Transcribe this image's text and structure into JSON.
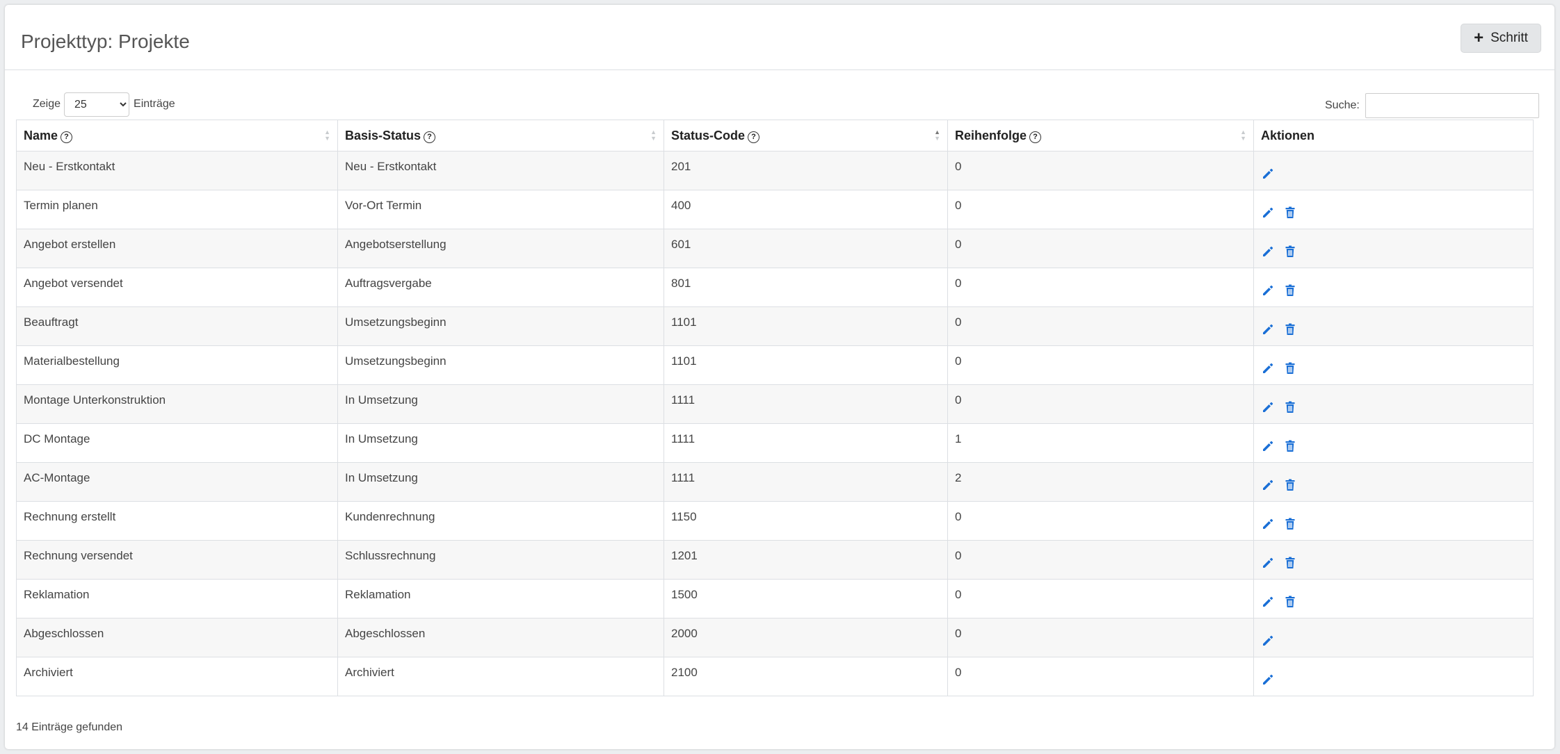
{
  "header": {
    "title": "Projekttyp: Projekte",
    "add_button_label": "Schritt"
  },
  "length": {
    "prefix": "Zeige",
    "value": "25",
    "suffix": "Einträge"
  },
  "search": {
    "label": "Suche:",
    "value": ""
  },
  "columns": [
    "Name",
    "Basis-Status",
    "Status-Code",
    "Reihenfolge",
    "Aktionen"
  ],
  "rows": [
    {
      "name": "Neu - Erstkontakt",
      "basis": "Neu - Erstkontakt",
      "code": "201",
      "order": "0",
      "deletable": false
    },
    {
      "name": "Termin planen",
      "basis": "Vor-Ort Termin",
      "code": "400",
      "order": "0",
      "deletable": true
    },
    {
      "name": "Angebot erstellen",
      "basis": "Angebotserstellung",
      "code": "601",
      "order": "0",
      "deletable": true
    },
    {
      "name": "Angebot versendet",
      "basis": "Auftragsvergabe",
      "code": "801",
      "order": "0",
      "deletable": true
    },
    {
      "name": "Beauftragt",
      "basis": "Umsetzungsbeginn",
      "code": "1101",
      "order": "0",
      "deletable": true
    },
    {
      "name": "Materialbestellung",
      "basis": "Umsetzungsbeginn",
      "code": "1101",
      "order": "0",
      "deletable": true
    },
    {
      "name": "Montage Unterkonstruktion",
      "basis": "In Umsetzung",
      "code": "1111",
      "order": "0",
      "deletable": true
    },
    {
      "name": "DC Montage",
      "basis": "In Umsetzung",
      "code": "1111",
      "order": "1",
      "deletable": true
    },
    {
      "name": "AC-Montage",
      "basis": "In Umsetzung",
      "code": "1111",
      "order": "2",
      "deletable": true
    },
    {
      "name": "Rechnung erstellt",
      "basis": "Kundenrechnung",
      "code": "1150",
      "order": "0",
      "deletable": true
    },
    {
      "name": "Rechnung versendet",
      "basis": "Schlussrechnung",
      "code": "1201",
      "order": "0",
      "deletable": true
    },
    {
      "name": "Reklamation",
      "basis": "Reklamation",
      "code": "1500",
      "order": "0",
      "deletable": true
    },
    {
      "name": "Abgeschlossen",
      "basis": "Abgeschlossen",
      "code": "2000",
      "order": "0",
      "deletable": false
    },
    {
      "name": "Archiviert",
      "basis": "Archiviert",
      "code": "2100",
      "order": "0",
      "deletable": false
    }
  ],
  "footer": {
    "info": "14 Einträge gefunden"
  },
  "colors": {
    "action_icon": "#1a6fd6",
    "row_stripe": "#f7f7f7"
  }
}
